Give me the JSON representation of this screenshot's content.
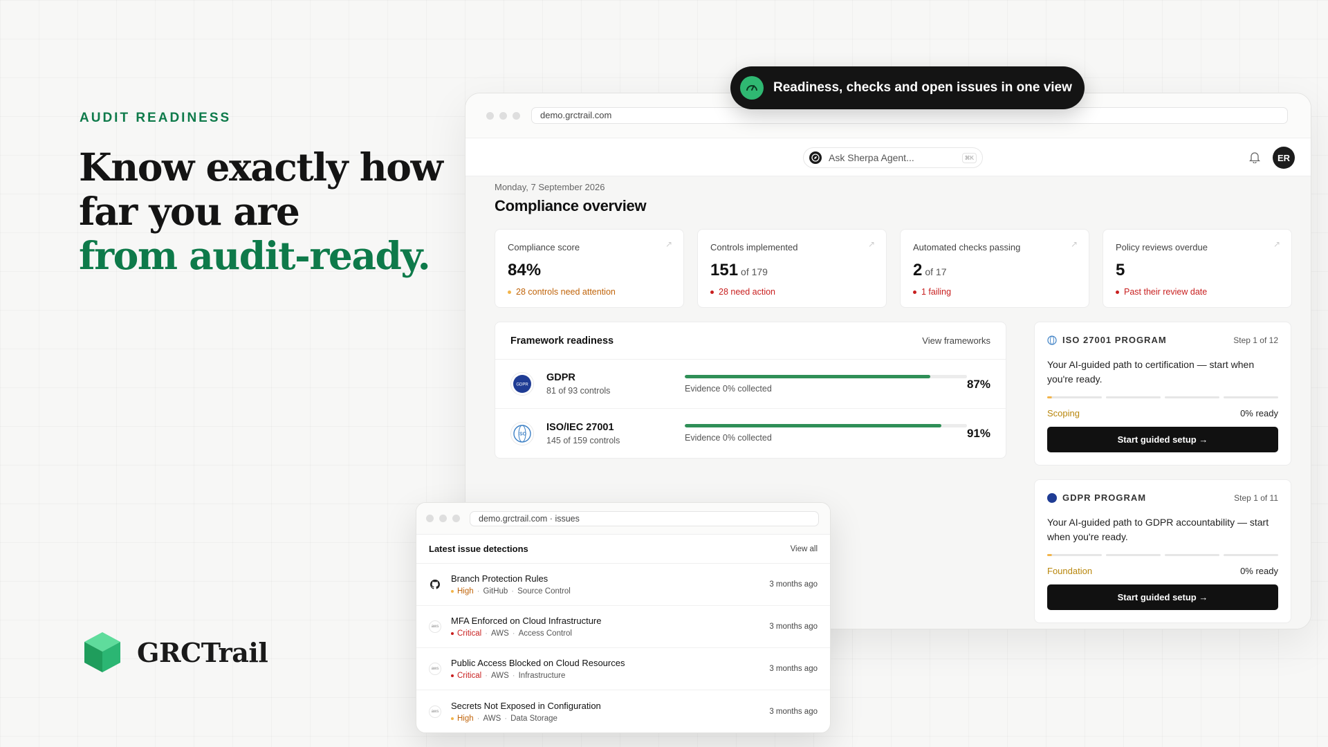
{
  "hero": {
    "eyebrow": "AUDIT READINESS",
    "line1": "Know exactly how",
    "line2": "far you are",
    "line3": "from audit-ready."
  },
  "brand": {
    "name": "GRCTrail",
    "icon": "green-cube-icon",
    "color": "#2bb673"
  },
  "pill": {
    "text": "Readiness, checks and open issues in one view",
    "icon": "gauge-icon"
  },
  "browser": {
    "url": "demo.grctrail.com"
  },
  "app": {
    "search_placeholder": "Ask Sherpa Agent...",
    "shortcut": "⌘K",
    "avatar": "ER",
    "date": "Monday, 7 September 2026",
    "title": "Compliance overview"
  },
  "stats": [
    {
      "label": "Compliance score",
      "value": "84%",
      "of": "",
      "sub": "28 controls need attention",
      "tone": "amber"
    },
    {
      "label": "Controls implemented",
      "value": "151",
      "of": "of 179",
      "sub": "28 need action",
      "tone": "red"
    },
    {
      "label": "Automated checks passing",
      "value": "2",
      "of": "of 17",
      "sub": "1 failing",
      "tone": "red"
    },
    {
      "label": "Policy reviews overdue",
      "value": "5",
      "of": "",
      "sub": "Past their review date",
      "tone": "red"
    }
  ],
  "frameworks": {
    "title": "Framework readiness",
    "link": "View frameworks",
    "items": [
      {
        "name": "GDPR",
        "controls": "81 of 93 controls",
        "evidence": "Evidence 0% collected",
        "pct": "87%",
        "progress": 0.87
      },
      {
        "name": "ISO/IEC 27001",
        "controls": "145 of 159 controls",
        "evidence": "Evidence 0% collected",
        "pct": "91%",
        "progress": 0.91
      }
    ]
  },
  "programs": [
    {
      "title": "ISO 27001 PROGRAM",
      "step": "Step 1 of 12",
      "desc": "Your AI-guided path to certification — start when you're ready.",
      "phase": "Scoping",
      "ready": "0% ready",
      "button": "Start guided setup →"
    },
    {
      "title": "GDPR PROGRAM",
      "step": "Step 1 of 11",
      "desc": "Your AI-guided path to GDPR accountability — start when you're ready.",
      "phase": "Foundation",
      "ready": "0% ready",
      "button": "Start guided setup →"
    }
  ],
  "issues": {
    "url": "demo.grctrail.com · issues",
    "title": "Latest issue detections",
    "link": "View all",
    "items": [
      {
        "name": "Branch Protection Rules",
        "severity": "High",
        "source": "GitHub",
        "category": "Source Control",
        "time": "3 months ago",
        "icon": "github-icon"
      },
      {
        "name": "MFA Enforced on Cloud Infrastructure",
        "severity": "Critical",
        "source": "AWS",
        "category": "Access Control",
        "time": "3 months ago",
        "icon": "aws-icon"
      },
      {
        "name": "Public Access Blocked on Cloud Resources",
        "severity": "Critical",
        "source": "AWS",
        "category": "Infrastructure",
        "time": "3 months ago",
        "icon": "aws-icon"
      },
      {
        "name": "Secrets Not Exposed in Configuration",
        "severity": "High",
        "source": "AWS",
        "category": "Data Storage",
        "time": "3 months ago",
        "icon": "aws-icon"
      }
    ]
  },
  "colors": {
    "accent_green": "#0e7a4a",
    "progress_green": "#2f8f57",
    "amber": "#c0640a",
    "red": "#c81f1f"
  }
}
